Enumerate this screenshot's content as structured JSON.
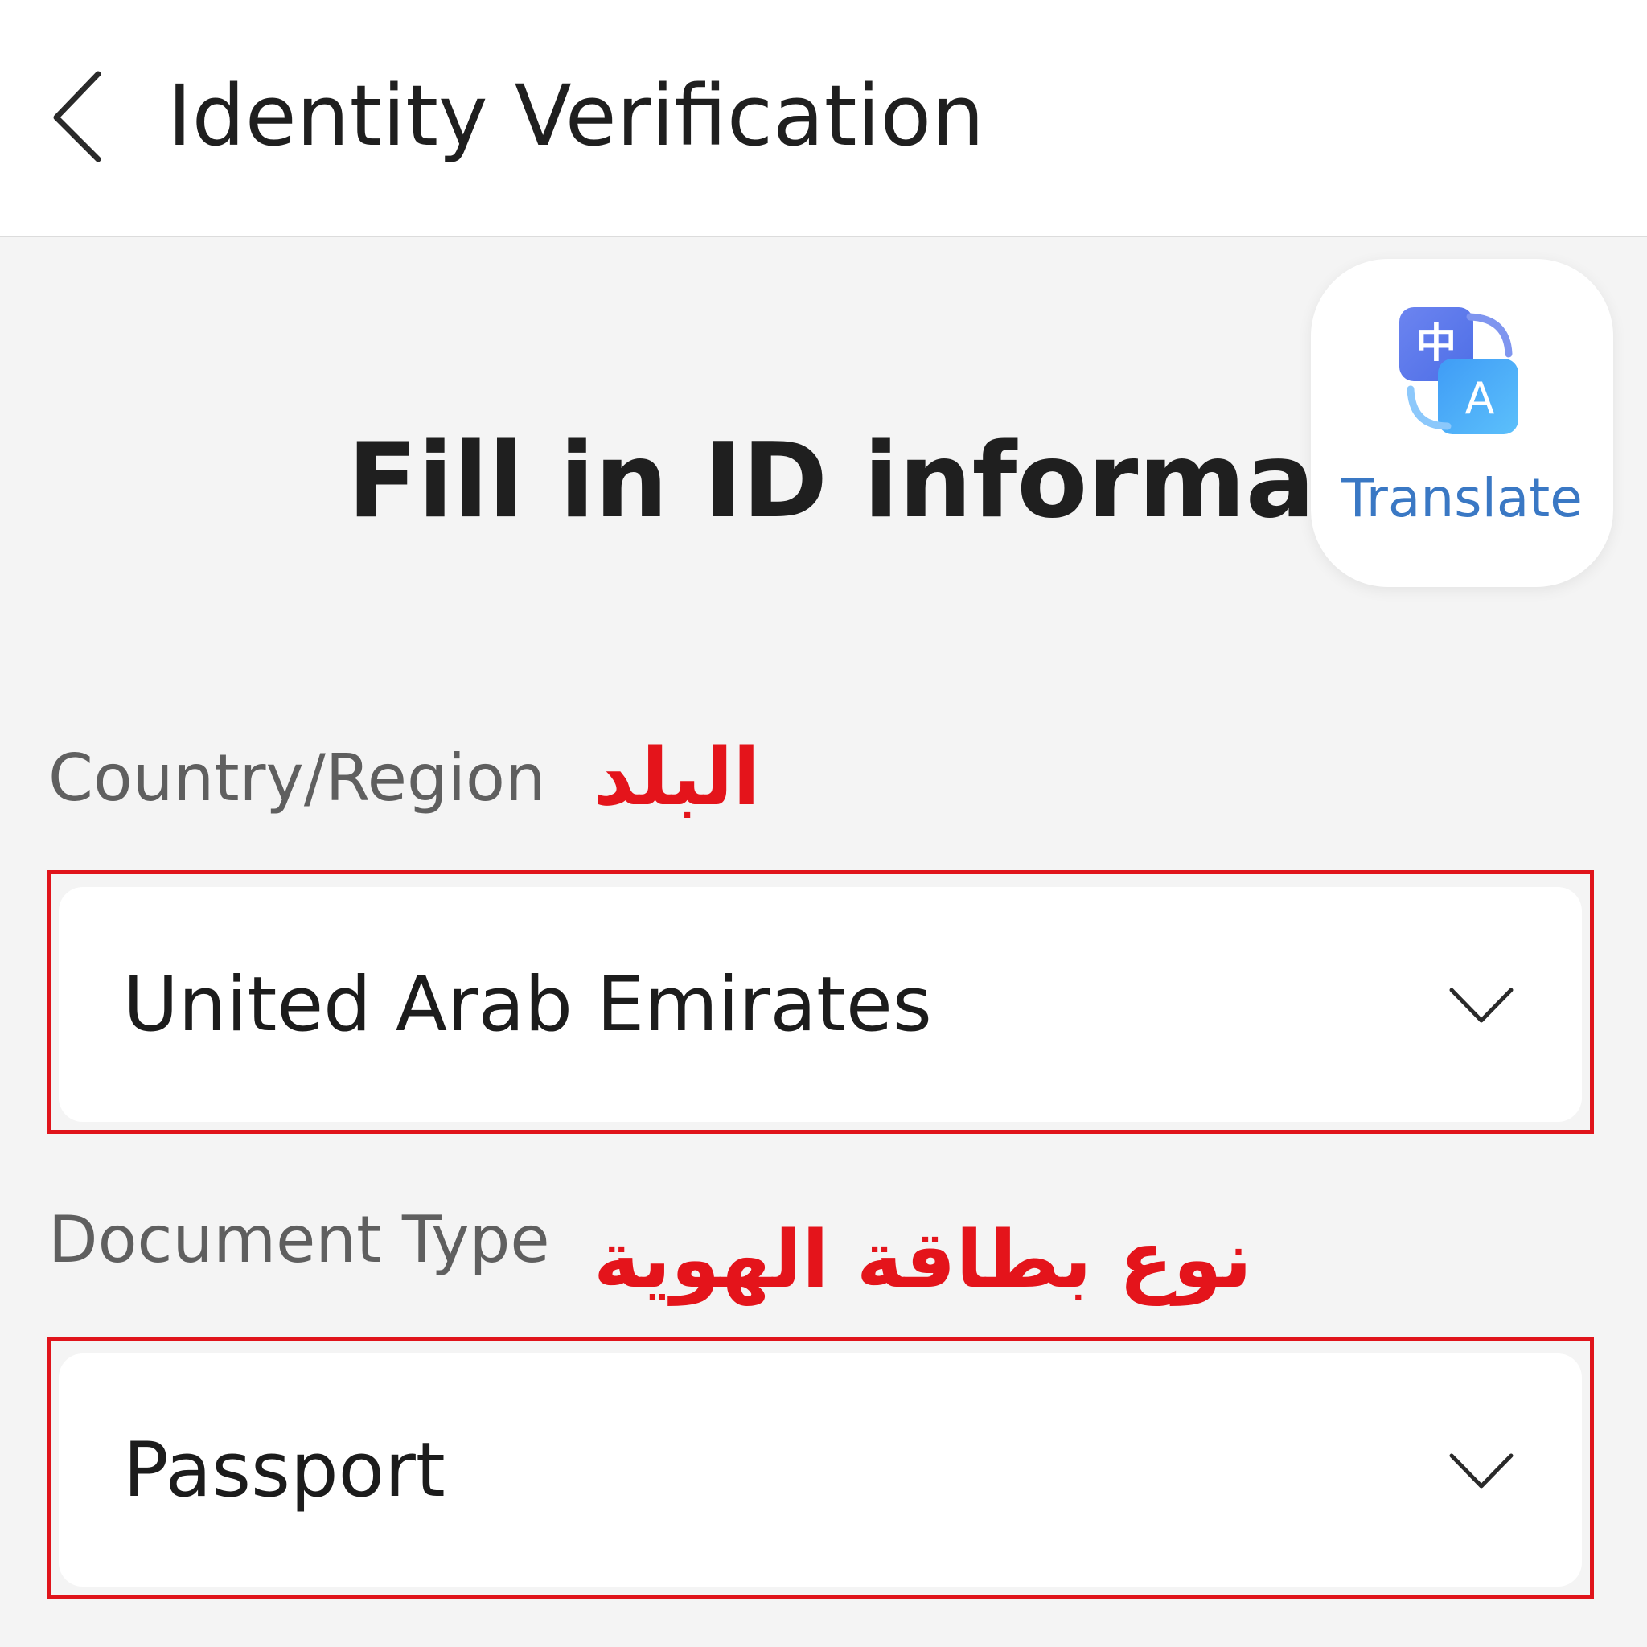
{
  "header": {
    "title": "Identity Verification"
  },
  "page": {
    "title": "Fill in ID information"
  },
  "translate": {
    "label": "Translate",
    "icon_glyph_cn": "中",
    "icon_glyph_en": "A"
  },
  "fields": [
    {
      "label": "Country/Region",
      "annotation": "البلد",
      "value": "United Arab Emirates"
    },
    {
      "label": "Document Type",
      "annotation": "نوع بطاقة الهوية",
      "value": "Passport"
    }
  ],
  "colors": {
    "accent_red": "#e0141b",
    "translate_blue": "#3a78c4",
    "background": "#f4f4f4"
  }
}
